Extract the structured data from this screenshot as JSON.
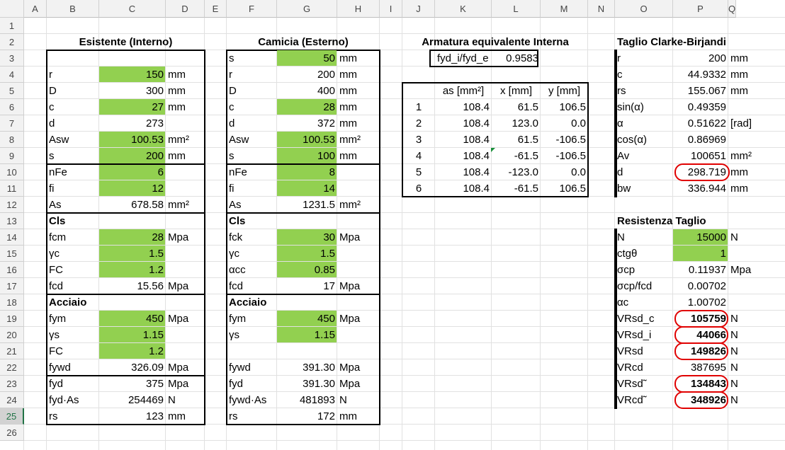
{
  "columns": [
    "A",
    "B",
    "C",
    "D",
    "E",
    "F",
    "G",
    "H",
    "I",
    "J",
    "K",
    "L",
    "M",
    "N",
    "O",
    "P",
    "Q"
  ],
  "rows": [
    "1",
    "2",
    "3",
    "4",
    "5",
    "6",
    "7",
    "8",
    "9",
    "10",
    "11",
    "12",
    "13",
    "14",
    "15",
    "16",
    "17",
    "18",
    "19",
    "20",
    "21",
    "22",
    "23",
    "24",
    "25",
    "26"
  ],
  "colors": {
    "input_fill": "#92d050",
    "highlight_oval": "#e00000",
    "header_bg": "#f2f2f2",
    "selected_row": "#217346"
  },
  "sections": {
    "esistente": {
      "title": "Esistente (Interno)",
      "rows": [
        {
          "label": "r",
          "value": "150",
          "unit": "mm",
          "input": true
        },
        {
          "label": "D",
          "value": "300",
          "unit": "mm",
          "input": false
        },
        {
          "label": "c",
          "value": "27",
          "unit": "mm",
          "input": true
        },
        {
          "label": "d",
          "value": "273",
          "unit": "",
          "input": false
        },
        {
          "label": "Asw",
          "value": "100.53",
          "unit": "mm²",
          "input": true
        },
        {
          "label": "s",
          "value": "200",
          "unit": "mm",
          "input": true
        },
        {
          "label": "nFe",
          "value": "6",
          "unit": "",
          "input": true
        },
        {
          "label": "fi",
          "value": "12",
          "unit": "",
          "input": true
        },
        {
          "label": "As",
          "value": "678.58",
          "unit": "mm²",
          "input": false
        },
        {
          "label": "Cls",
          "value": "",
          "unit": "",
          "input": false,
          "bold": true
        },
        {
          "label": "fcm",
          "value": "28",
          "unit": "Mpa",
          "input": true
        },
        {
          "label": " γc",
          "value": "1.5",
          "unit": "",
          "input": true
        },
        {
          "label": "FC",
          "value": "1.2",
          "unit": "",
          "input": true
        },
        {
          "label": "fcd",
          "value": "15.56",
          "unit": "Mpa",
          "input": false
        },
        {
          "label": "Acciaio",
          "value": "",
          "unit": "",
          "input": false,
          "bold": true
        },
        {
          "label": "fym",
          "value": "450",
          "unit": "Mpa",
          "input": true
        },
        {
          "label": "γs",
          "value": "1.15",
          "unit": "",
          "input": true
        },
        {
          "label": "FC",
          "value": "1.2",
          "unit": "",
          "input": true
        },
        {
          "label": "fywd",
          "value": "326.09",
          "unit": "Mpa",
          "input": false
        },
        {
          "label": "fyd",
          "value": "375",
          "unit": "Mpa",
          "input": false
        },
        {
          "label": "fyd·As",
          "value": "254469",
          "unit": "N",
          "input": false
        },
        {
          "label": "rs",
          "value": "123",
          "unit": "mm",
          "input": false
        }
      ]
    },
    "camicia": {
      "title": "Camicia (Esterno)",
      "rows": [
        {
          "label": "s",
          "value": "50",
          "unit": "mm",
          "input": true
        },
        {
          "label": "r",
          "value": "200",
          "unit": "mm",
          "input": false
        },
        {
          "label": "D",
          "value": "400",
          "unit": "mm",
          "input": false
        },
        {
          "label": "c",
          "value": "28",
          "unit": "mm",
          "input": true
        },
        {
          "label": "d",
          "value": "372",
          "unit": "mm",
          "input": false
        },
        {
          "label": "Asw",
          "value": "100.53",
          "unit": "mm²",
          "input": true
        },
        {
          "label": "s",
          "value": "100",
          "unit": "mm",
          "input": true
        },
        {
          "label": "nFe",
          "value": "8",
          "unit": "",
          "input": true
        },
        {
          "label": "fi",
          "value": "14",
          "unit": "",
          "input": true
        },
        {
          "label": "As",
          "value": "1231.5",
          "unit": "mm²",
          "input": false
        },
        {
          "label": "Cls",
          "value": "",
          "unit": "",
          "input": false,
          "bold": true
        },
        {
          "label": "fck",
          "value": "30",
          "unit": "Mpa",
          "input": true
        },
        {
          "label": "γc",
          "value": "1.5",
          "unit": "",
          "input": true
        },
        {
          "label": "αcc",
          "value": "0.85",
          "unit": "",
          "input": true
        },
        {
          "label": "fcd",
          "value": "17",
          "unit": "Mpa",
          "input": false
        },
        {
          "label": "Acciaio",
          "value": "",
          "unit": "",
          "input": false,
          "bold": true
        },
        {
          "label": "fym",
          "value": "450",
          "unit": "Mpa",
          "input": true
        },
        {
          "label": "γs",
          "value": "1.15",
          "unit": "",
          "input": true
        },
        {
          "label": "",
          "value": "",
          "unit": "",
          "input": false
        },
        {
          "label": "fywd",
          "value": "391.30",
          "unit": "Mpa",
          "input": false
        },
        {
          "label": "fyd",
          "value": "391.30",
          "unit": "Mpa",
          "input": false
        },
        {
          "label": "fywd·As",
          "value": "481893",
          "unit": "N",
          "input": false
        },
        {
          "label": "rs",
          "value": "172",
          "unit": "mm",
          "input": false
        }
      ]
    },
    "armatura": {
      "title": "Armatura equivalente Interna",
      "ratio_label": "fyd_i/fyd_e",
      "ratio_value": "0.9583",
      "headers": [
        "as [mm²]",
        "x [mm]",
        "y  [mm]"
      ],
      "rows": [
        {
          "n": "1",
          "as": "108.4",
          "x": "61.5",
          "y": "106.5"
        },
        {
          "n": "2",
          "as": "108.4",
          "x": "123.0",
          "y": "0.0"
        },
        {
          "n": "3",
          "as": "108.4",
          "x": "61.5",
          "y": "-106.5"
        },
        {
          "n": "4",
          "as": "108.4",
          "x": "-61.5",
          "y": "-106.5"
        },
        {
          "n": "5",
          "as": "108.4",
          "x": "-123.0",
          "y": "0.0"
        },
        {
          "n": "6",
          "as": "108.4",
          "x": "-61.5",
          "y": "106.5"
        }
      ]
    },
    "taglio": {
      "title": "Taglio Clarke-Birjandi",
      "rows": [
        {
          "label": "r",
          "value": "200",
          "unit": "mm"
        },
        {
          "label": "c",
          "value": "44.9332",
          "unit": "mm"
        },
        {
          "label": "rs",
          "value": "155.067",
          "unit": "mm"
        },
        {
          "label": "sin(α)",
          "value": "0.49359",
          "unit": ""
        },
        {
          "label": "α",
          "value": "0.51622",
          "unit": "[rad]"
        },
        {
          "label": "cos(α)",
          "value": "0.86969",
          "unit": ""
        },
        {
          "label": "Av",
          "value": "100651",
          "unit": "mm²"
        },
        {
          "label": "d",
          "value": "298.719",
          "unit": "mm",
          "circled": true
        },
        {
          "label": "bw",
          "value": "336.944",
          "unit": "mm"
        }
      ]
    },
    "resistenza": {
      "title": "Resistenza Taglio",
      "rows": [
        {
          "label": "N",
          "value": "15000",
          "unit": "N",
          "input": true
        },
        {
          "label": "ctgθ",
          "value": "1",
          "unit": "",
          "input": true
        },
        {
          "label": "σcp",
          "value": "0.11937",
          "unit": "Mpa"
        },
        {
          "label": "σcp/fcd",
          "value": "0.00702",
          "unit": ""
        },
        {
          "label": "αc",
          "value": "1.00702",
          "unit": ""
        },
        {
          "label": "VRsd_c",
          "value": "105759",
          "unit": "N",
          "circled": true,
          "bold": true
        },
        {
          "label": "VRsd_i",
          "value": "44066",
          "unit": "N",
          "circled": true,
          "bold": true
        },
        {
          "label": "VRsd",
          "value": "149826",
          "unit": "N",
          "circled": true,
          "bold": true
        },
        {
          "label": "VRcd",
          "value": "387695",
          "unit": "N"
        },
        {
          "label": "VRsd˜",
          "value": "134843",
          "unit": "N",
          "circled": true,
          "bold": true
        },
        {
          "label": "VRcd˜",
          "value": "348926",
          "unit": "N",
          "circled": true,
          "bold": true
        }
      ]
    }
  }
}
